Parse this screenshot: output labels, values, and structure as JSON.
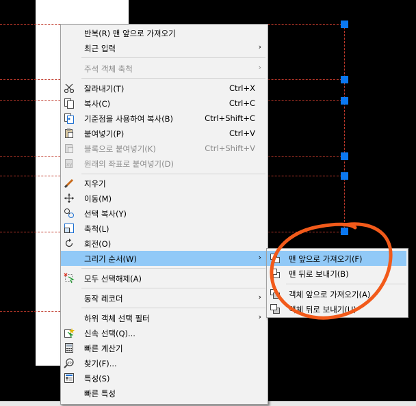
{
  "menu": {
    "items": [
      {
        "label": "반복(R) 맨 앞으로 가져오기",
        "shortcut": "",
        "submenu": false,
        "disabled": false,
        "icon": ""
      },
      {
        "label": "최근 입력",
        "shortcut": "",
        "submenu": true,
        "disabled": false,
        "icon": ""
      },
      {
        "label": "주석 객체 축척",
        "shortcut": "",
        "submenu": true,
        "disabled": true,
        "icon": ""
      },
      {
        "label": "잘라내기(T)",
        "shortcut": "Ctrl+X",
        "submenu": false,
        "disabled": false,
        "icon": "scissors-icon"
      },
      {
        "label": "복사(C)",
        "shortcut": "Ctrl+C",
        "submenu": false,
        "disabled": false,
        "icon": "copy-icon"
      },
      {
        "label": "기준점을 사용하여 복사(B)",
        "shortcut": "Ctrl+Shift+C",
        "submenu": false,
        "disabled": false,
        "icon": "copy-base-icon"
      },
      {
        "label": "붙여넣기(P)",
        "shortcut": "Ctrl+V",
        "submenu": false,
        "disabled": false,
        "icon": "paste-icon"
      },
      {
        "label": "블록으로 붙여넣기(K)",
        "shortcut": "Ctrl+Shift+V",
        "submenu": false,
        "disabled": true,
        "icon": "paste-block-icon"
      },
      {
        "label": "원래의 좌표로 붙여넣기(D)",
        "shortcut": "",
        "submenu": false,
        "disabled": true,
        "icon": "paste-original-icon"
      },
      {
        "label": "지우기",
        "shortcut": "",
        "submenu": false,
        "disabled": false,
        "icon": "eraser-icon"
      },
      {
        "label": "이동(M)",
        "shortcut": "",
        "submenu": false,
        "disabled": false,
        "icon": "move-icon"
      },
      {
        "label": "선택 복사(Y)",
        "shortcut": "",
        "submenu": false,
        "disabled": false,
        "icon": "copy-select-icon"
      },
      {
        "label": "축척(L)",
        "shortcut": "",
        "submenu": false,
        "disabled": false,
        "icon": "scale-icon"
      },
      {
        "label": "회전(O)",
        "shortcut": "",
        "submenu": false,
        "disabled": false,
        "icon": "rotate-icon"
      },
      {
        "label": "그리기 순서(W)",
        "shortcut": "",
        "submenu": true,
        "disabled": false,
        "icon": "",
        "highlighted": true
      },
      {
        "label": "모두 선택해제(A)",
        "shortcut": "",
        "submenu": false,
        "disabled": false,
        "icon": "deselect-icon"
      },
      {
        "label": "동작 레코더",
        "shortcut": "",
        "submenu": true,
        "disabled": false,
        "icon": ""
      },
      {
        "label": "하위 객체 선택 필터",
        "shortcut": "",
        "submenu": true,
        "disabled": false,
        "icon": ""
      },
      {
        "label": "신속 선택(Q)...",
        "shortcut": "",
        "submenu": false,
        "disabled": false,
        "icon": "quick-select-icon"
      },
      {
        "label": "빠른 계산기",
        "shortcut": "",
        "submenu": false,
        "disabled": false,
        "icon": "calculator-icon"
      },
      {
        "label": "찾기(F)...",
        "shortcut": "",
        "submenu": false,
        "disabled": false,
        "icon": "find-icon"
      },
      {
        "label": "특성(S)",
        "shortcut": "",
        "submenu": false,
        "disabled": false,
        "icon": "properties-icon"
      },
      {
        "label": "빠른 특성",
        "shortcut": "",
        "submenu": false,
        "disabled": false,
        "icon": ""
      }
    ]
  },
  "submenu": {
    "items": [
      {
        "label": "맨 앞으로 가져오기(F)",
        "highlighted": true
      },
      {
        "label": "맨 뒤로 보내기(B)",
        "highlighted": false
      },
      {
        "label": "객체 앞으로 가져오기(A)",
        "highlighted": false
      },
      {
        "label": "객체 뒤로 보내기(U)",
        "highlighted": false
      }
    ]
  },
  "colors": {
    "highlight": "#91c9f7",
    "grip": "#0b78f0",
    "annotation": "#f25a1a",
    "guide": "#c0392b"
  }
}
